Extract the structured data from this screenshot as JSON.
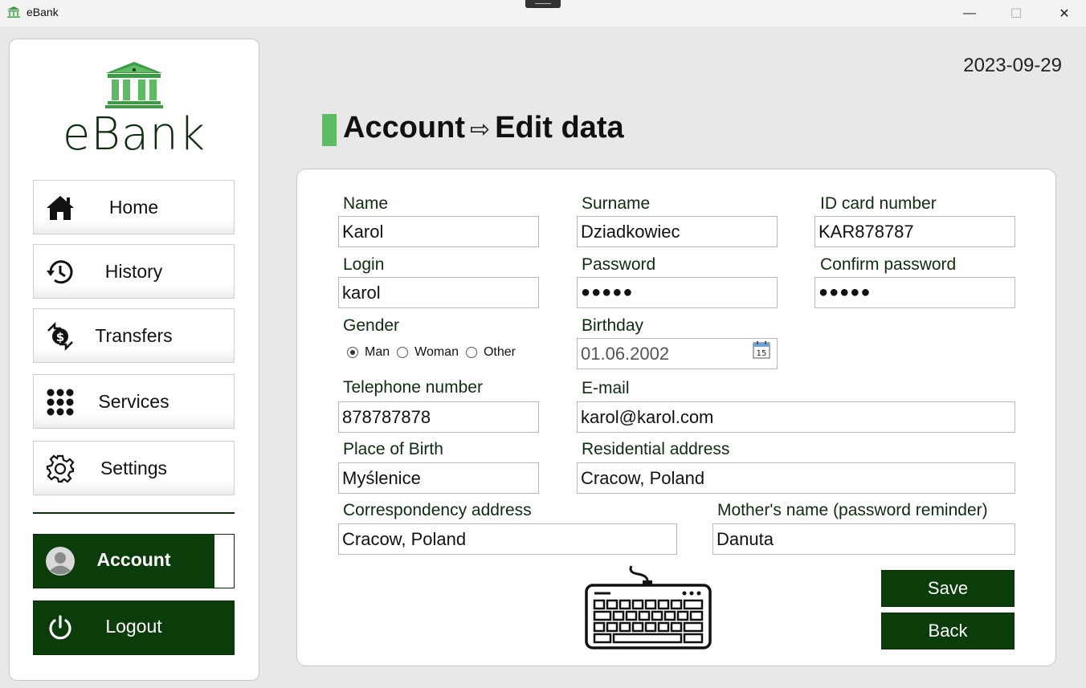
{
  "window": {
    "title": "eBank",
    "app_icon": "bank-icon",
    "controls": {
      "minimize": "—",
      "maximize": "☐",
      "close": "✕"
    }
  },
  "sidebar": {
    "logo_text": "eBank",
    "nav": [
      {
        "id": "home",
        "label": "Home",
        "icon": "home-icon"
      },
      {
        "id": "history",
        "label": "History",
        "icon": "history-icon"
      },
      {
        "id": "transfers",
        "label": "Transfers",
        "icon": "transfers-icon"
      },
      {
        "id": "services",
        "label": "Services",
        "icon": "grid-icon"
      },
      {
        "id": "settings",
        "label": "Settings",
        "icon": "gear-icon"
      }
    ],
    "account_label": "Account",
    "logout_label": "Logout"
  },
  "header": {
    "date": "2023-09-29",
    "title_main": "Account",
    "title_arrow": "⇨",
    "title_sub": "Edit data"
  },
  "form": {
    "name": {
      "label": "Name",
      "value": "Karol"
    },
    "surname": {
      "label": "Surname",
      "value": "Dziadkowiec"
    },
    "id_card": {
      "label": "ID card number",
      "value": "KAR878787"
    },
    "login": {
      "label": "Login",
      "value": "karol"
    },
    "password": {
      "label": "Password",
      "value": "●●●●●"
    },
    "confirm_password": {
      "label": "Confirm password",
      "value": "●●●●●"
    },
    "gender": {
      "label": "Gender",
      "options": [
        "Man",
        "Woman",
        "Other"
      ],
      "selected": "Man"
    },
    "birthday": {
      "label": "Birthday",
      "value": "01.06.2002",
      "calendar_day": "15"
    },
    "telephone": {
      "label": "Telephone number",
      "value": "878787878"
    },
    "email": {
      "label": "E-mail",
      "value": "karol@karol.com"
    },
    "place_of_birth": {
      "label": "Place of Birth",
      "value": "Myślenice"
    },
    "residential_address": {
      "label": "Residential address",
      "value": "Cracow, Poland"
    },
    "correspondency_address": {
      "label": "Correspondency address",
      "value": "Cracow, Poland"
    },
    "mothers_name": {
      "label": "Mother's name (password reminder)",
      "value": "Danuta"
    }
  },
  "actions": {
    "save_label": "Save",
    "back_label": "Back",
    "keyboard_icon": "keyboard-icon"
  },
  "colors": {
    "brand_dark_green": "#0b3d0b",
    "accent_green": "#5dbb63",
    "label_green": "#0f2b10",
    "background": "#e8e8e8"
  }
}
